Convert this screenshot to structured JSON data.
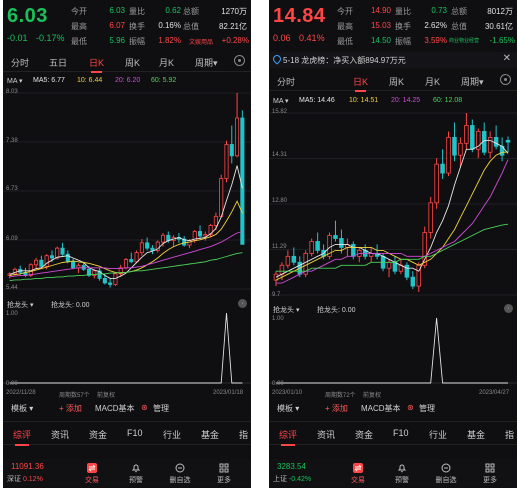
{
  "panels": [
    {
      "price": "6.03",
      "price_color": "#19c15a",
      "change": "-0.01",
      "change_pct": "-0.17%",
      "quote": [
        {
          "k1": "今开",
          "v1": "6.03",
          "c1": "#19c15a",
          "k2": "量比",
          "v2": "0.62",
          "c2": "#19c15a",
          "k3": "总额",
          "v3": "1270万",
          "c3": "#e0e0e0"
        },
        {
          "k1": "最高",
          "v1": "6.07",
          "c1": "#ff4545",
          "k2": "换手",
          "v2": "0.16%",
          "c2": "#e0e0e0",
          "k3": "总值",
          "v3": "82.21亿",
          "c3": "#e0e0e0"
        },
        {
          "k1": "最低",
          "v1": "5.96",
          "c1": "#19c15a",
          "k2": "振幅",
          "v2": "1.82%",
          "c2": "#ff4545",
          "k3": "文娱用品",
          "v3": "+0.28%",
          "c3": "#ff4545"
        }
      ],
      "tabs": [
        "分时",
        "五日",
        "日K",
        "周K",
        "月K",
        "周期▾"
      ],
      "active_tab": "日K",
      "notice": "",
      "ma": {
        "label": "MA ▾",
        "ma5": "MA5: 6.77",
        "ma10": "10: 6.44",
        "ma20": "20: 6.20",
        "ma60": "60: 5.92"
      },
      "y_labels": [
        "8.03",
        "7.38",
        "6.73",
        "6.09",
        "5.44"
      ],
      "x_labels": [
        "2022/11/28",
        "周期数57个",
        "前复权",
        "2023/01/18"
      ],
      "indicator": {
        "label": "抢龙头 ▾",
        "value": "抢龙头: 0.00",
        "y_top": "1.00",
        "y_bottom": "0.00"
      },
      "toolbar": {
        "template": "模板 ▾",
        "add": "+ 添加",
        "macd": "MACD基本",
        "manage": "管理"
      },
      "info_tabs": [
        "综评",
        "资讯",
        "资金",
        "F10",
        "行业",
        "基金",
        "指"
      ],
      "active_info": "综评",
      "index": {
        "value": "11091.36",
        "name": "深证",
        "pct": "0.12%",
        "color": "#ff4545"
      },
      "nav": [
        "交易",
        "预警",
        "删自选",
        "更多"
      ],
      "chart_data": {
        "type": "candlestick",
        "ylim": [
          5.44,
          8.03
        ],
        "candles": [
          [
            5.62,
            5.66,
            5.58,
            5.64
          ],
          [
            5.64,
            5.72,
            5.62,
            5.7
          ],
          [
            5.7,
            5.75,
            5.63,
            5.66
          ],
          [
            5.66,
            5.72,
            5.6,
            5.62
          ],
          [
            5.62,
            5.78,
            5.6,
            5.76
          ],
          [
            5.76,
            5.85,
            5.7,
            5.82
          ],
          [
            5.82,
            5.88,
            5.72,
            5.74
          ],
          [
            5.74,
            5.9,
            5.7,
            5.88
          ],
          [
            5.88,
            5.95,
            5.8,
            5.85
          ],
          [
            5.85,
            6.0,
            5.83,
            5.98
          ],
          [
            5.98,
            6.05,
            5.88,
            5.9
          ],
          [
            5.9,
            5.95,
            5.78,
            5.8
          ],
          [
            5.8,
            5.84,
            5.7,
            5.72
          ],
          [
            5.72,
            5.78,
            5.65,
            5.75
          ],
          [
            5.75,
            5.8,
            5.68,
            5.7
          ],
          [
            5.7,
            5.74,
            5.6,
            5.62
          ],
          [
            5.62,
            5.7,
            5.58,
            5.68
          ],
          [
            5.68,
            5.72,
            5.55,
            5.58
          ],
          [
            5.58,
            5.64,
            5.5,
            5.52
          ],
          [
            5.52,
            5.58,
            5.46,
            5.5
          ],
          [
            5.5,
            5.66,
            5.48,
            5.64
          ],
          [
            5.64,
            5.76,
            5.6,
            5.72
          ],
          [
            5.72,
            5.85,
            5.7,
            5.83
          ],
          [
            5.83,
            5.92,
            5.78,
            5.8
          ],
          [
            5.8,
            5.95,
            5.78,
            5.92
          ],
          [
            5.92,
            6.1,
            5.88,
            6.05
          ],
          [
            6.05,
            6.12,
            5.95,
            5.98
          ],
          [
            5.98,
            6.02,
            5.9,
            5.95
          ],
          [
            5.95,
            6.08,
            5.92,
            6.06
          ],
          [
            6.06,
            6.18,
            6.0,
            6.15
          ],
          [
            6.15,
            6.2,
            6.05,
            6.08
          ],
          [
            6.08,
            6.15,
            6.0,
            6.12
          ],
          [
            6.12,
            6.18,
            6.05,
            6.1
          ],
          [
            6.1,
            6.14,
            6.0,
            6.02
          ],
          [
            6.02,
            6.1,
            5.98,
            6.08
          ],
          [
            6.08,
            6.22,
            6.05,
            6.2
          ],
          [
            6.2,
            6.28,
            6.1,
            6.14
          ],
          [
            6.14,
            6.2,
            6.08,
            6.16
          ],
          [
            6.16,
            6.3,
            6.12,
            6.28
          ],
          [
            6.28,
            6.45,
            6.22,
            6.4
          ],
          [
            6.4,
            6.95,
            6.38,
            6.9
          ],
          [
            6.9,
            7.4,
            6.85,
            7.35
          ],
          [
            7.35,
            7.6,
            7.1,
            7.2
          ],
          [
            7.2,
            8.03,
            7.18,
            7.7
          ],
          [
            7.7,
            7.8,
            6.05,
            6.03
          ]
        ],
        "ma5": [
          5.63,
          5.66,
          5.68,
          5.68,
          5.68,
          5.71,
          5.72,
          5.78,
          5.82,
          5.86,
          5.87,
          5.88,
          5.85,
          5.82,
          5.79,
          5.72,
          5.69,
          5.67,
          5.62,
          5.58,
          5.58,
          5.61,
          5.65,
          5.72,
          5.79,
          5.86,
          5.92,
          5.94,
          5.97,
          6.04,
          6.08,
          6.1,
          6.12,
          6.09,
          6.08,
          6.1,
          6.11,
          6.12,
          6.17,
          6.24,
          6.39,
          6.61,
          6.82,
          7.07,
          6.77
        ],
        "ma10": [
          5.62,
          5.63,
          5.64,
          5.66,
          5.67,
          5.69,
          5.71,
          5.73,
          5.75,
          5.77,
          5.79,
          5.8,
          5.81,
          5.8,
          5.79,
          5.78,
          5.76,
          5.74,
          5.71,
          5.68,
          5.66,
          5.65,
          5.66,
          5.67,
          5.69,
          5.72,
          5.76,
          5.8,
          5.85,
          5.91,
          5.96,
          6.0,
          6.03,
          6.05,
          6.06,
          6.08,
          6.09,
          6.11,
          6.13,
          6.16,
          6.23,
          6.34,
          6.46,
          6.6,
          6.44
        ],
        "ma20": [
          5.6,
          5.61,
          5.62,
          5.62,
          5.63,
          5.64,
          5.65,
          5.66,
          5.67,
          5.68,
          5.69,
          5.7,
          5.71,
          5.72,
          5.72,
          5.72,
          5.72,
          5.72,
          5.72,
          5.71,
          5.71,
          5.71,
          5.72,
          5.72,
          5.73,
          5.74,
          5.76,
          5.78,
          5.8,
          5.82,
          5.84,
          5.86,
          5.88,
          5.9,
          5.92,
          5.94,
          5.96,
          5.98,
          6.0,
          6.03,
          6.06,
          6.1,
          6.14,
          6.18,
          6.2
        ],
        "ma60": [
          5.55,
          5.56,
          5.56,
          5.57,
          5.57,
          5.58,
          5.58,
          5.59,
          5.59,
          5.6,
          5.6,
          5.61,
          5.61,
          5.62,
          5.62,
          5.63,
          5.63,
          5.64,
          5.64,
          5.65,
          5.65,
          5.66,
          5.66,
          5.67,
          5.68,
          5.68,
          5.69,
          5.7,
          5.71,
          5.72,
          5.73,
          5.74,
          5.75,
          5.76,
          5.77,
          5.78,
          5.79,
          5.8,
          5.82,
          5.83,
          5.85,
          5.87,
          5.89,
          5.91,
          5.92
        ],
        "indicator": [
          0,
          0,
          0,
          0,
          0,
          0,
          0,
          0,
          0,
          0,
          0,
          0,
          0,
          0,
          0,
          0,
          0,
          0,
          0,
          0,
          0,
          0,
          0,
          0,
          0,
          0,
          0,
          0,
          0,
          0,
          0,
          0,
          0,
          0,
          0,
          0,
          0,
          0,
          0,
          0,
          0,
          1,
          0,
          0,
          0
        ]
      }
    },
    {
      "price": "14.84",
      "price_color": "#ff4545",
      "change": "0.06",
      "change_pct": "0.41%",
      "quote": [
        {
          "k1": "今开",
          "v1": "14.90",
          "c1": "#ff4545",
          "k2": "量比",
          "v2": "0.73",
          "c2": "#19c15a",
          "k3": "总额",
          "v3": "8012万",
          "c3": "#e0e0e0"
        },
        {
          "k1": "最高",
          "v1": "15.03",
          "c1": "#ff4545",
          "k2": "换手",
          "v2": "2.62%",
          "c2": "#e0e0e0",
          "k3": "总值",
          "v3": "30.61亿",
          "c3": "#e0e0e0"
        },
        {
          "k1": "最低",
          "v1": "14.50",
          "c1": "#19c15a",
          "k2": "振幅",
          "v2": "3.59%",
          "c2": "#ff4545",
          "k3": "商业物业经营",
          "v3": "-1.65%",
          "c3": "#19c15a"
        }
      ],
      "tabs": [
        "分时",
        "日K",
        "周K",
        "月K",
        "周期▾"
      ],
      "active_tab": "日K",
      "notice": "5-18 龙虎榜：净买入额894.97万元",
      "ma": {
        "label": "MA ▾",
        "ma5": "MA5: 14.46",
        "ma10": "10: 14.51",
        "ma20": "20: 14.25",
        "ma60": "60: 12.08"
      },
      "y_labels": [
        "15.82",
        "14.31",
        "12.80",
        "11.29",
        "9.7"
      ],
      "x_labels": [
        "2023/01/10",
        "周期数72个",
        "前复权",
        "2023/04/27"
      ],
      "indicator": {
        "label": "抢龙头 ▾",
        "value": "抢龙头: 0.00",
        "y_top": "1.00",
        "y_bottom": "0.00"
      },
      "toolbar": {
        "template": "模板 ▾",
        "add": "+ 添加",
        "macd": "MACD基本",
        "manage": "管理"
      },
      "info_tabs": [
        "综评",
        "资讯",
        "资金",
        "F10",
        "行业",
        "基金",
        "指"
      ],
      "active_info": "综评",
      "index": {
        "value": "3283.54",
        "name": "上证",
        "pct": "-0.42%",
        "color": "#19c15a"
      },
      "nav": [
        "交易",
        "预警",
        "删自选",
        "更多"
      ],
      "chart_data": {
        "type": "candlestick",
        "ylim": [
          9.7,
          15.82
        ],
        "candles": [
          [
            10.2,
            10.5,
            10.0,
            10.4
          ],
          [
            10.4,
            10.8,
            10.2,
            10.7
          ],
          [
            10.7,
            11.2,
            10.6,
            11.0
          ],
          [
            11.0,
            11.3,
            10.7,
            10.8
          ],
          [
            10.8,
            11.0,
            10.3,
            10.4
          ],
          [
            10.4,
            11.2,
            10.3,
            11.1
          ],
          [
            11.1,
            11.6,
            11.0,
            11.5
          ],
          [
            11.5,
            11.8,
            11.1,
            11.2
          ],
          [
            11.2,
            11.4,
            10.9,
            11.0
          ],
          [
            11.0,
            11.8,
            10.9,
            11.7
          ],
          [
            11.7,
            12.2,
            11.5,
            11.6
          ],
          [
            11.6,
            11.9,
            11.1,
            11.3
          ],
          [
            11.3,
            11.6,
            11.0,
            11.4
          ],
          [
            11.4,
            11.5,
            10.9,
            11.0
          ],
          [
            11.0,
            11.3,
            10.8,
            11.2
          ],
          [
            11.2,
            11.4,
            10.9,
            11.0
          ],
          [
            11.0,
            11.3,
            10.8,
            11.1
          ],
          [
            11.1,
            11.4,
            10.9,
            11.0
          ],
          [
            11.0,
            11.1,
            10.5,
            10.6
          ],
          [
            10.6,
            10.9,
            10.3,
            10.8
          ],
          [
            10.8,
            11.0,
            10.4,
            10.5
          ],
          [
            10.5,
            10.9,
            10.4,
            10.7
          ],
          [
            10.7,
            10.8,
            10.2,
            10.3
          ],
          [
            10.3,
            10.5,
            9.9,
            10.0
          ],
          [
            10.0,
            10.8,
            9.8,
            10.7
          ],
          [
            10.7,
            12.0,
            10.6,
            11.8
          ],
          [
            11.8,
            13.0,
            11.6,
            12.8
          ],
          [
            12.8,
            14.3,
            12.6,
            14.1
          ],
          [
            14.1,
            14.6,
            13.6,
            13.8
          ],
          [
            13.8,
            15.2,
            13.7,
            15.0
          ],
          [
            15.0,
            15.5,
            14.2,
            14.4
          ],
          [
            14.4,
            15.0,
            14.0,
            14.8
          ],
          [
            14.8,
            15.82,
            14.6,
            15.4
          ],
          [
            15.4,
            15.6,
            14.5,
            14.6
          ],
          [
            14.6,
            15.3,
            14.3,
            15.2
          ],
          [
            15.2,
            15.5,
            14.4,
            14.5
          ],
          [
            14.5,
            15.2,
            14.3,
            15.0
          ],
          [
            15.0,
            15.4,
            14.6,
            14.7
          ],
          [
            14.7,
            15.0,
            14.2,
            14.4
          ],
          [
            14.9,
            15.03,
            14.5,
            14.84
          ]
        ],
        "ma5": [
          10.3,
          10.4,
          10.5,
          10.6,
          10.7,
          10.8,
          10.9,
          11.0,
          11.1,
          11.3,
          11.4,
          11.4,
          11.4,
          11.3,
          11.3,
          11.2,
          11.1,
          11.1,
          11.0,
          10.9,
          10.8,
          10.7,
          10.6,
          10.6,
          10.5,
          10.9,
          11.3,
          11.8,
          12.2,
          12.7,
          13.4,
          14.0,
          14.6,
          14.6,
          14.7,
          14.9,
          14.9,
          14.8,
          14.7,
          14.46
        ],
        "ma10": [
          10.2,
          10.3,
          10.4,
          10.5,
          10.6,
          10.7,
          10.8,
          10.9,
          11.0,
          11.1,
          11.2,
          11.2,
          11.3,
          11.3,
          11.3,
          11.3,
          11.3,
          11.2,
          11.2,
          11.1,
          11.0,
          10.9,
          10.9,
          10.8,
          10.7,
          10.8,
          10.9,
          11.1,
          11.3,
          11.6,
          11.9,
          12.3,
          12.7,
          13.1,
          13.5,
          13.9,
          14.2,
          14.4,
          14.5,
          14.51
        ],
        "ma20": [
          10.1,
          10.1,
          10.2,
          10.3,
          10.4,
          10.5,
          10.5,
          10.6,
          10.7,
          10.8,
          10.9,
          10.9,
          11.0,
          11.0,
          11.1,
          11.1,
          11.1,
          11.1,
          11.1,
          11.1,
          11.1,
          11.1,
          11.0,
          11.0,
          11.0,
          11.0,
          11.1,
          11.2,
          11.3,
          11.4,
          11.5,
          11.7,
          11.9,
          12.1,
          12.4,
          12.7,
          13.0,
          13.4,
          13.8,
          14.25
        ],
        "ma60": [
          10.5,
          10.5,
          10.5,
          10.5,
          10.5,
          10.5,
          10.6,
          10.6,
          10.6,
          10.6,
          10.6,
          10.7,
          10.7,
          10.7,
          10.7,
          10.7,
          10.8,
          10.8,
          10.8,
          10.8,
          10.8,
          10.9,
          10.9,
          10.9,
          10.9,
          11.0,
          11.0,
          11.1,
          11.2,
          11.3,
          11.4,
          11.5,
          11.6,
          11.7,
          11.8,
          11.9,
          11.95,
          12.0,
          12.05,
          12.08
        ],
        "indicator": [
          0,
          0,
          0,
          0,
          0,
          0,
          0,
          0,
          0,
          0,
          0,
          0,
          0,
          0,
          0,
          0,
          0,
          0,
          0,
          0,
          0,
          0,
          0,
          0,
          0,
          0,
          0,
          1,
          0,
          0,
          0,
          0,
          0,
          0,
          0,
          0,
          0,
          0,
          0,
          0
        ]
      }
    }
  ]
}
